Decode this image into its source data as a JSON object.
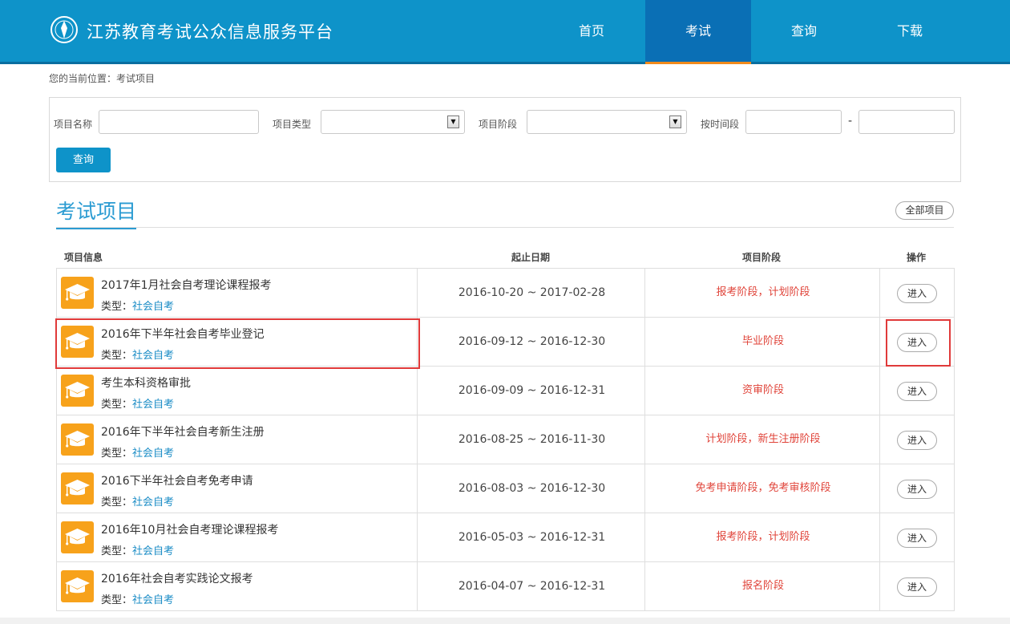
{
  "header": {
    "site_title": "江苏教育考试公众信息服务平台",
    "nav": [
      {
        "label": "首页",
        "active": false
      },
      {
        "label": "考试",
        "active": true
      },
      {
        "label": "查询",
        "active": false
      },
      {
        "label": "下载",
        "active": false
      }
    ],
    "colors": {
      "header_bg": "#0e93c9",
      "active_nav_bg": "#0a6fb5",
      "active_underline": "#f08a1c"
    }
  },
  "breadcrumb": "您的当前位置：考试项目",
  "search": {
    "name_label": "项目名称",
    "name_value": "",
    "type_label": "项目类型",
    "type_value": "",
    "stage_label": "项目阶段",
    "stage_value": "",
    "period_label": "按时间段",
    "period_from": "",
    "period_sep": "-",
    "period_to": "",
    "query_label": "查询"
  },
  "section": {
    "title": "考试项目",
    "all_button": "全部项目"
  },
  "table": {
    "headers": [
      "项目信息",
      "起止日期",
      "项目阶段",
      "操作"
    ],
    "type_prefix": "类型：",
    "rows": [
      {
        "title": "2017年1月社会自考理论课程报考",
        "type": "社会自考",
        "dates": "2016-10-20 ~ 2017-02-28",
        "stage": "报考阶段，计划阶段",
        "action": "进入"
      },
      {
        "title": "2016年下半年社会自考毕业登记",
        "type": "社会自考",
        "dates": "2016-09-12 ~ 2016-12-30",
        "stage": "毕业阶段",
        "action": "进入"
      },
      {
        "title": "考生本科资格审批",
        "type": "社会自考",
        "dates": "2016-09-09 ~ 2016-12-31",
        "stage": "资审阶段",
        "action": "进入"
      },
      {
        "title": "2016年下半年社会自考新生注册",
        "type": "社会自考",
        "dates": "2016-08-25 ~ 2016-11-30",
        "stage": "计划阶段，新生注册阶段",
        "action": "进入"
      },
      {
        "title": "2016下半年社会自考免考申请",
        "type": "社会自考",
        "dates": "2016-08-03 ~ 2016-12-30",
        "stage": "免考申请阶段，免考审核阶段",
        "action": "进入"
      },
      {
        "title": "2016年10月社会自考理论课程报考",
        "type": "社会自考",
        "dates": "2016-05-03 ~ 2016-12-31",
        "stage": "报考阶段，计划阶段",
        "action": "进入"
      },
      {
        "title": "2016年社会自考实践论文报考",
        "type": "社会自考",
        "dates": "2016-04-07 ~ 2016-12-31",
        "stage": "报名阶段",
        "action": "进入"
      }
    ]
  },
  "icons": {
    "row_icon": "graduation-cap-icon",
    "logo": "exam-logo-icon"
  },
  "colors": {
    "accent": "#2a9bd2",
    "stage_text": "#e0443a",
    "icon_bg": "#f7a21b",
    "highlight": "#e03a3a"
  }
}
